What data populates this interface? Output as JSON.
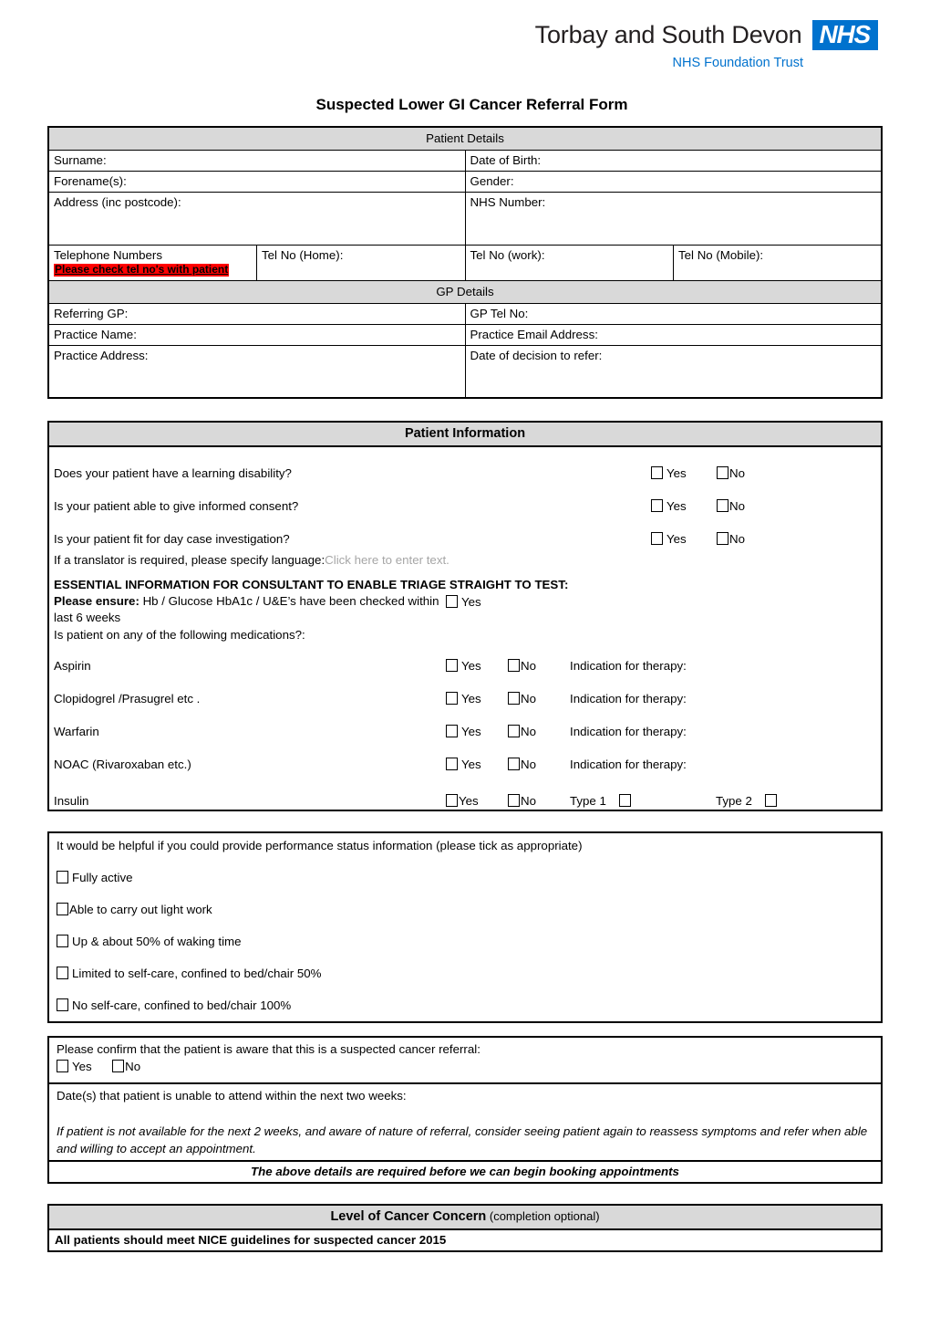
{
  "header": {
    "trust_name": "Torbay and South Devon",
    "nhs_logo_text": "NHS",
    "foundation_trust": "NHS Foundation Trust"
  },
  "title": "Suspected Lower GI Cancer Referral Form",
  "patient_details": {
    "band": "Patient Details",
    "surname_label": "Surname:",
    "dob_label": "Date of Birth:",
    "forename_label": "Forename(s):",
    "gender_label": "Gender:",
    "address_label": "Address (inc postcode):",
    "nhs_number_label": "NHS Number:",
    "telephone_numbers_label": "Telephone Numbers",
    "telephone_warning": "Please check tel no's with patient",
    "tel_home_label": "Tel No (Home):",
    "tel_work_label": "Tel No (work):",
    "tel_mobile_label": "Tel No (Mobile):"
  },
  "gp_details": {
    "band": "GP Details",
    "referring_gp_label": "Referring GP:",
    "gp_tel_label": "GP Tel No:",
    "practice_name_label": "Practice Name:",
    "practice_email_label": "Practice Email Address:",
    "practice_address_label": "Practice Address:",
    "decision_date_label": "Date of decision to refer:"
  },
  "patient_information": {
    "band": "Patient Information",
    "questions": [
      {
        "text": "Does your patient have a learning disability?",
        "yes": "Yes",
        "no": "No"
      },
      {
        "text": "Is your patient able to give informed consent?",
        "yes": "Yes",
        "no": "No"
      },
      {
        "text": "Is your patient fit for day case investigation?",
        "yes": "Yes",
        "no": "No"
      }
    ],
    "translator_label": "If a translator is required, please specify language:",
    "translator_placeholder": "Click here to enter text.",
    "essential_heading": "ESSENTIAL INFORMATION FOR CONSULTANT TO ENABLE TRIAGE STRAIGHT TO TEST:",
    "ensure_bold": "Please ensure:",
    "ensure_text": " Hb / Glucose HbA1c / U&E’s have been checked within last 6 weeks",
    "ensure_yes": "Yes",
    "medications_question": "Is patient on any of the following medications?:",
    "indication_label": "Indication for therapy:",
    "medications": [
      {
        "name": "Aspirin",
        "yes": "Yes",
        "no": "No",
        "indication": "Indication for therapy:"
      },
      {
        "name": "Clopidogrel /Prasugrel etc .",
        "yes": "Yes",
        "no": "No",
        "indication": "Indication for therapy:"
      },
      {
        "name": "Warfarin",
        "yes": "Yes",
        "no": "No",
        "indication": "Indication for therapy:"
      },
      {
        "name": "NOAC (Rivaroxaban etc.)",
        "yes": "Yes",
        "no": "No",
        "indication": "Indication for therapy:"
      }
    ],
    "insulin": {
      "name": "Insulin",
      "yes": "Yes",
      "no": "No",
      "type1": "Type 1",
      "type2": "Type 2"
    }
  },
  "performance_status": {
    "intro": "It would be helpful if you could provide performance status information (please tick as appropriate)",
    "options": [
      "Fully active",
      "Able to carry out light work",
      "Up & about 50% of waking time",
      "Limited to self-care, confined to bed/chair 50%",
      "No self-care, confined to bed/chair 100%"
    ]
  },
  "confirmation": {
    "confirm_text": "Please confirm that the patient is aware that this is a suspected cancer referral:",
    "yes": "Yes",
    "no": "No",
    "dates_label": "Date(s) that patient is unable to attend within the next two weeks:",
    "italic_note": "If patient is not available for the next 2 weeks, and aware of nature of referral, consider seeing patient again to reassess symptoms and refer when able and willing to accept an appointment.",
    "required_note": "The above details are required before we can begin booking appointments"
  },
  "cancer_concern": {
    "band_main": "Level of Cancer Concern",
    "band_sub": " (completion optional)",
    "nice_note": "All patients should meet NICE guidelines for suspected cancer 2015"
  }
}
